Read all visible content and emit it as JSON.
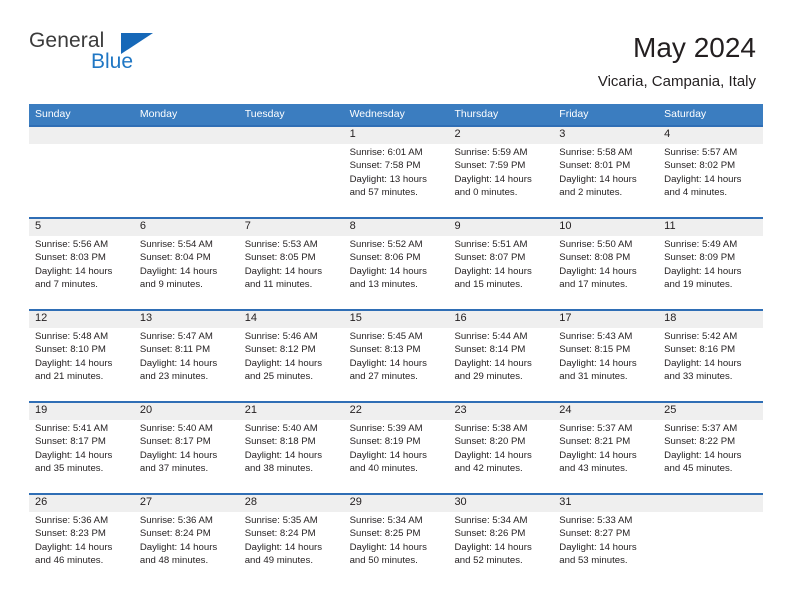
{
  "brand": {
    "name_top": "General",
    "name_bottom": "Blue",
    "color_top": "#3b3b3b",
    "color_bottom": "#2077c4",
    "triangle_color": "#1668b8"
  },
  "header": {
    "title": "May 2024",
    "subtitle": "Vicaria, Campania, Italy"
  },
  "theme": {
    "header_bg": "#3b7dc0",
    "header_text": "#ffffff",
    "daynum_band": "#efefef",
    "row_divider": "#2f6eb5",
    "text": "#231f20"
  },
  "weekdays": [
    "Sunday",
    "Monday",
    "Tuesday",
    "Wednesday",
    "Thursday",
    "Friday",
    "Saturday"
  ],
  "weeks": [
    [
      {
        "day": "",
        "sunrise": "",
        "sunset": "",
        "daylight1": "",
        "daylight2": ""
      },
      {
        "day": "",
        "sunrise": "",
        "sunset": "",
        "daylight1": "",
        "daylight2": ""
      },
      {
        "day": "",
        "sunrise": "",
        "sunset": "",
        "daylight1": "",
        "daylight2": ""
      },
      {
        "day": "1",
        "sunrise": "Sunrise: 6:01 AM",
        "sunset": "Sunset: 7:58 PM",
        "daylight1": "Daylight: 13 hours",
        "daylight2": "and 57 minutes."
      },
      {
        "day": "2",
        "sunrise": "Sunrise: 5:59 AM",
        "sunset": "Sunset: 7:59 PM",
        "daylight1": "Daylight: 14 hours",
        "daylight2": "and 0 minutes."
      },
      {
        "day": "3",
        "sunrise": "Sunrise: 5:58 AM",
        "sunset": "Sunset: 8:01 PM",
        "daylight1": "Daylight: 14 hours",
        "daylight2": "and 2 minutes."
      },
      {
        "day": "4",
        "sunrise": "Sunrise: 5:57 AM",
        "sunset": "Sunset: 8:02 PM",
        "daylight1": "Daylight: 14 hours",
        "daylight2": "and 4 minutes."
      }
    ],
    [
      {
        "day": "5",
        "sunrise": "Sunrise: 5:56 AM",
        "sunset": "Sunset: 8:03 PM",
        "daylight1": "Daylight: 14 hours",
        "daylight2": "and 7 minutes."
      },
      {
        "day": "6",
        "sunrise": "Sunrise: 5:54 AM",
        "sunset": "Sunset: 8:04 PM",
        "daylight1": "Daylight: 14 hours",
        "daylight2": "and 9 minutes."
      },
      {
        "day": "7",
        "sunrise": "Sunrise: 5:53 AM",
        "sunset": "Sunset: 8:05 PM",
        "daylight1": "Daylight: 14 hours",
        "daylight2": "and 11 minutes."
      },
      {
        "day": "8",
        "sunrise": "Sunrise: 5:52 AM",
        "sunset": "Sunset: 8:06 PM",
        "daylight1": "Daylight: 14 hours",
        "daylight2": "and 13 minutes."
      },
      {
        "day": "9",
        "sunrise": "Sunrise: 5:51 AM",
        "sunset": "Sunset: 8:07 PM",
        "daylight1": "Daylight: 14 hours",
        "daylight2": "and 15 minutes."
      },
      {
        "day": "10",
        "sunrise": "Sunrise: 5:50 AM",
        "sunset": "Sunset: 8:08 PM",
        "daylight1": "Daylight: 14 hours",
        "daylight2": "and 17 minutes."
      },
      {
        "day": "11",
        "sunrise": "Sunrise: 5:49 AM",
        "sunset": "Sunset: 8:09 PM",
        "daylight1": "Daylight: 14 hours",
        "daylight2": "and 19 minutes."
      }
    ],
    [
      {
        "day": "12",
        "sunrise": "Sunrise: 5:48 AM",
        "sunset": "Sunset: 8:10 PM",
        "daylight1": "Daylight: 14 hours",
        "daylight2": "and 21 minutes."
      },
      {
        "day": "13",
        "sunrise": "Sunrise: 5:47 AM",
        "sunset": "Sunset: 8:11 PM",
        "daylight1": "Daylight: 14 hours",
        "daylight2": "and 23 minutes."
      },
      {
        "day": "14",
        "sunrise": "Sunrise: 5:46 AM",
        "sunset": "Sunset: 8:12 PM",
        "daylight1": "Daylight: 14 hours",
        "daylight2": "and 25 minutes."
      },
      {
        "day": "15",
        "sunrise": "Sunrise: 5:45 AM",
        "sunset": "Sunset: 8:13 PM",
        "daylight1": "Daylight: 14 hours",
        "daylight2": "and 27 minutes."
      },
      {
        "day": "16",
        "sunrise": "Sunrise: 5:44 AM",
        "sunset": "Sunset: 8:14 PM",
        "daylight1": "Daylight: 14 hours",
        "daylight2": "and 29 minutes."
      },
      {
        "day": "17",
        "sunrise": "Sunrise: 5:43 AM",
        "sunset": "Sunset: 8:15 PM",
        "daylight1": "Daylight: 14 hours",
        "daylight2": "and 31 minutes."
      },
      {
        "day": "18",
        "sunrise": "Sunrise: 5:42 AM",
        "sunset": "Sunset: 8:16 PM",
        "daylight1": "Daylight: 14 hours",
        "daylight2": "and 33 minutes."
      }
    ],
    [
      {
        "day": "19",
        "sunrise": "Sunrise: 5:41 AM",
        "sunset": "Sunset: 8:17 PM",
        "daylight1": "Daylight: 14 hours",
        "daylight2": "and 35 minutes."
      },
      {
        "day": "20",
        "sunrise": "Sunrise: 5:40 AM",
        "sunset": "Sunset: 8:17 PM",
        "daylight1": "Daylight: 14 hours",
        "daylight2": "and 37 minutes."
      },
      {
        "day": "21",
        "sunrise": "Sunrise: 5:40 AM",
        "sunset": "Sunset: 8:18 PM",
        "daylight1": "Daylight: 14 hours",
        "daylight2": "and 38 minutes."
      },
      {
        "day": "22",
        "sunrise": "Sunrise: 5:39 AM",
        "sunset": "Sunset: 8:19 PM",
        "daylight1": "Daylight: 14 hours",
        "daylight2": "and 40 minutes."
      },
      {
        "day": "23",
        "sunrise": "Sunrise: 5:38 AM",
        "sunset": "Sunset: 8:20 PM",
        "daylight1": "Daylight: 14 hours",
        "daylight2": "and 42 minutes."
      },
      {
        "day": "24",
        "sunrise": "Sunrise: 5:37 AM",
        "sunset": "Sunset: 8:21 PM",
        "daylight1": "Daylight: 14 hours",
        "daylight2": "and 43 minutes."
      },
      {
        "day": "25",
        "sunrise": "Sunrise: 5:37 AM",
        "sunset": "Sunset: 8:22 PM",
        "daylight1": "Daylight: 14 hours",
        "daylight2": "and 45 minutes."
      }
    ],
    [
      {
        "day": "26",
        "sunrise": "Sunrise: 5:36 AM",
        "sunset": "Sunset: 8:23 PM",
        "daylight1": "Daylight: 14 hours",
        "daylight2": "and 46 minutes."
      },
      {
        "day": "27",
        "sunrise": "Sunrise: 5:36 AM",
        "sunset": "Sunset: 8:24 PM",
        "daylight1": "Daylight: 14 hours",
        "daylight2": "and 48 minutes."
      },
      {
        "day": "28",
        "sunrise": "Sunrise: 5:35 AM",
        "sunset": "Sunset: 8:24 PM",
        "daylight1": "Daylight: 14 hours",
        "daylight2": "and 49 minutes."
      },
      {
        "day": "29",
        "sunrise": "Sunrise: 5:34 AM",
        "sunset": "Sunset: 8:25 PM",
        "daylight1": "Daylight: 14 hours",
        "daylight2": "and 50 minutes."
      },
      {
        "day": "30",
        "sunrise": "Sunrise: 5:34 AM",
        "sunset": "Sunset: 8:26 PM",
        "daylight1": "Daylight: 14 hours",
        "daylight2": "and 52 minutes."
      },
      {
        "day": "31",
        "sunrise": "Sunrise: 5:33 AM",
        "sunset": "Sunset: 8:27 PM",
        "daylight1": "Daylight: 14 hours",
        "daylight2": "and 53 minutes."
      },
      {
        "day": "",
        "sunrise": "",
        "sunset": "",
        "daylight1": "",
        "daylight2": ""
      }
    ]
  ]
}
